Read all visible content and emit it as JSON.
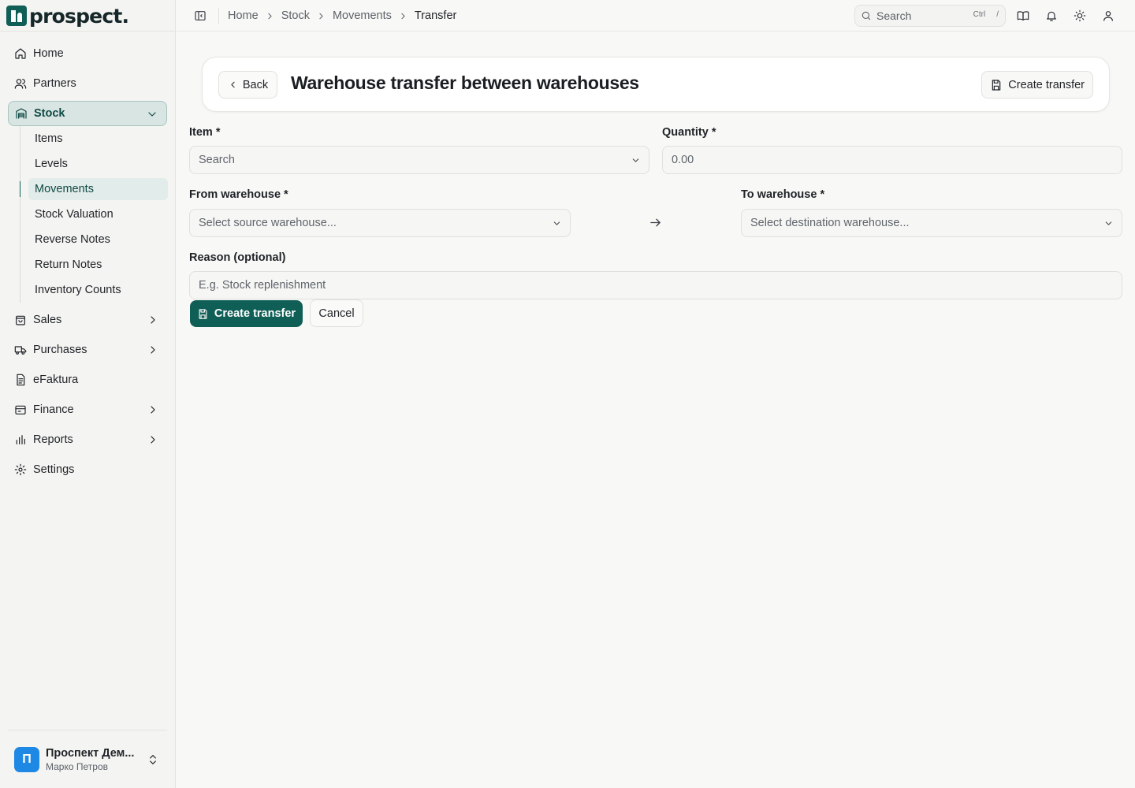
{
  "brand": {
    "name": "prospect."
  },
  "sidebar": {
    "items": [
      {
        "label": "Home",
        "icon": "home-icon"
      },
      {
        "label": "Partners",
        "icon": "users-icon"
      },
      {
        "label": "Stock",
        "icon": "warehouse-icon"
      },
      {
        "label": "Sales",
        "icon": "shopping-bag-icon"
      },
      {
        "label": "Purchases",
        "icon": "truck-icon"
      },
      {
        "label": "eFaktura",
        "icon": "document-icon"
      },
      {
        "label": "Finance",
        "icon": "wallet-icon"
      },
      {
        "label": "Reports",
        "icon": "bar-chart-icon"
      },
      {
        "label": "Settings",
        "icon": "gear-icon"
      }
    ],
    "stock_subitems": [
      "Items",
      "Levels",
      "Movements",
      "Stock Valuation",
      "Reverse Notes",
      "Return Notes",
      "Inventory Counts"
    ],
    "active_item": "Stock",
    "active_subitem": "Movements",
    "account": {
      "initial": "П",
      "name": "Проспект Дем...",
      "user": "Марко Петров"
    }
  },
  "topbar": {
    "breadcrumb": [
      "Home",
      "Stock",
      "Movements",
      "Transfer"
    ],
    "search": {
      "placeholder": "Search",
      "shortcut_key": "Ctrl",
      "shortcut_char": "/"
    },
    "icons": [
      "book-icon",
      "bell-icon",
      "sun-icon",
      "user-icon"
    ]
  },
  "header": {
    "back_label": "Back",
    "title": "Warehouse transfer between warehouses",
    "create_label": "Create transfer"
  },
  "form": {
    "item": {
      "label": "Item *",
      "placeholder": "Search"
    },
    "quantity": {
      "label": "Quantity *",
      "placeholder": "0.00"
    },
    "from_warehouse": {
      "label": "From warehouse *",
      "placeholder": "Select source warehouse..."
    },
    "to_warehouse": {
      "label": "To warehouse *",
      "placeholder": "Select destination warehouse..."
    },
    "reason": {
      "label": "Reason (optional)",
      "placeholder": "E.g. Stock replenishment"
    },
    "submit_label": "Create transfer",
    "cancel_label": "Cancel"
  },
  "colors": {
    "accent": "#0f5f57",
    "avatar": "#1e88e5"
  }
}
